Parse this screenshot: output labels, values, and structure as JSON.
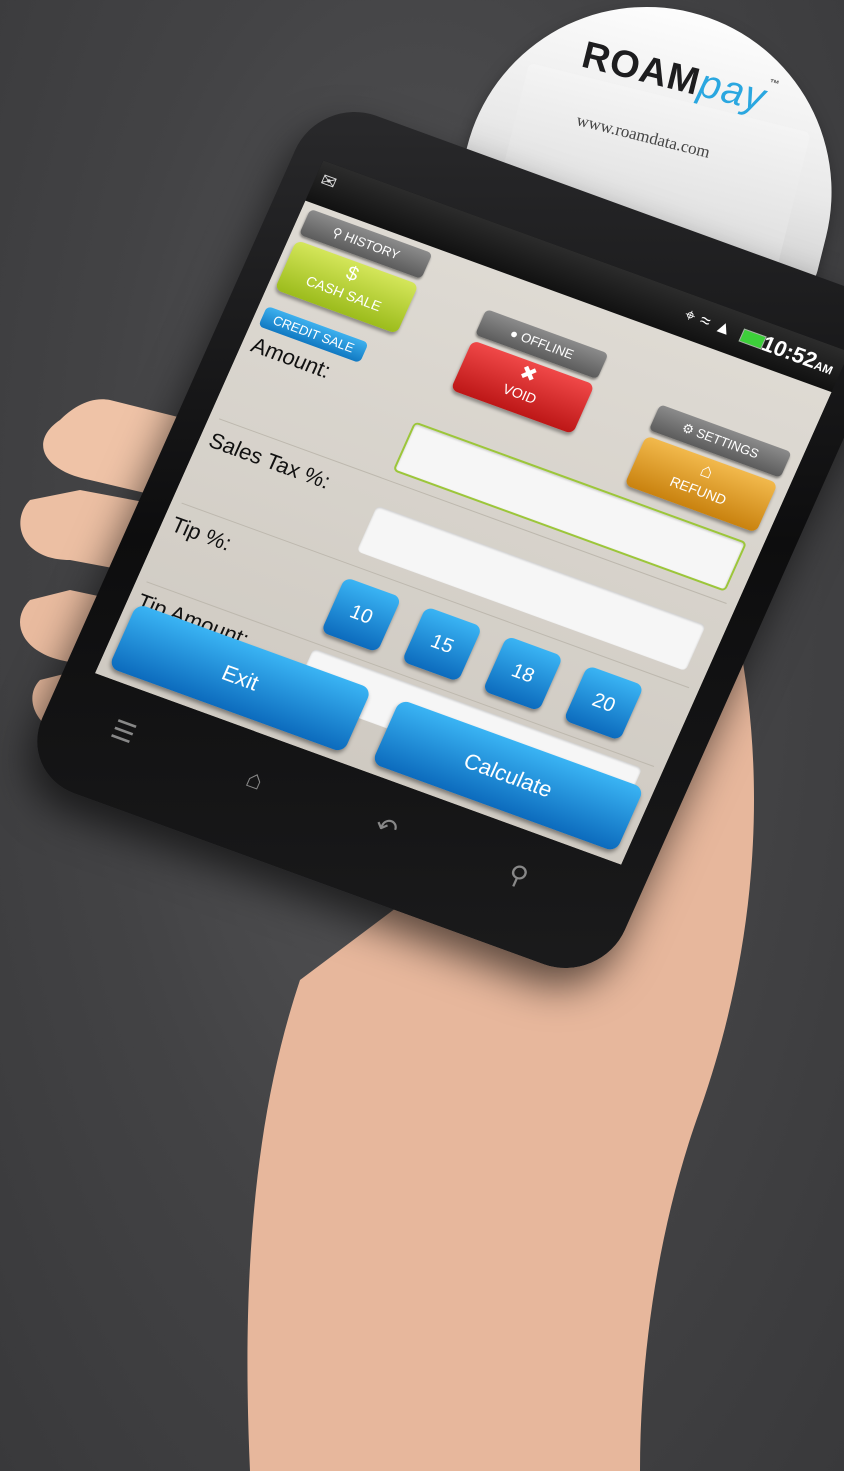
{
  "reader": {
    "brand_main": "ROAM",
    "brand_accent": "pay",
    "trademark": "™",
    "website": "www.roamdata.com"
  },
  "status_bar": {
    "time": "10:52",
    "meridiem": "AM"
  },
  "tabs": {
    "history": "HISTORY",
    "offline": "OFFLINE",
    "settings": "SETTINGS"
  },
  "actions": {
    "cash_sale": "CASH SALE",
    "void": "VOID",
    "refund": "REFUND",
    "credit_sale": "CREDIT SALE"
  },
  "form": {
    "amount_label": "Amount:",
    "amount_value": "",
    "sales_tax_label": "Sales Tax %:",
    "sales_tax_value": "",
    "tip_label": "Tip %:",
    "tip_options": [
      "10",
      "15",
      "18",
      "20"
    ],
    "tip_amount_label": "Tip Amount:",
    "tip_amount_value": ""
  },
  "footer": {
    "exit": "Exit",
    "calculate": "Calculate"
  },
  "colors": {
    "accent_blue": "#1a8fd8",
    "cash_green": "#a9c52b",
    "void_red": "#d92a2a",
    "refund_orange": "#e19a1e"
  },
  "icons": [
    "menu-icon",
    "home-icon",
    "back-icon",
    "search-icon"
  ]
}
